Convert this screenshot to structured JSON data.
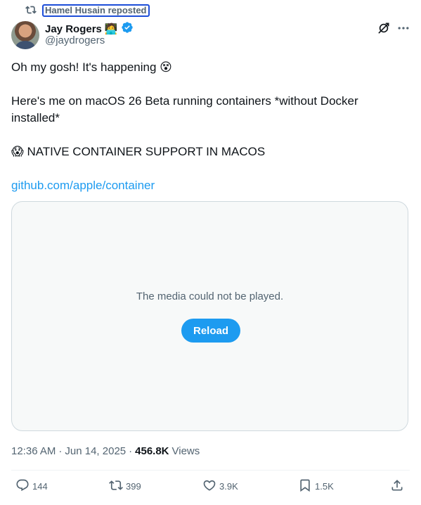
{
  "repost": {
    "label": "Hamel Husain reposted"
  },
  "author": {
    "name": "Jay Rogers",
    "badge_emoji": "🧑‍💻",
    "handle": "@jaydrogers"
  },
  "tweet": {
    "line1": "Oh my gosh! It's happening 😵",
    "line2": "Here's me on macOS 26 Beta running containers *without Docker installed*",
    "line3": "😱 NATIVE CONTAINER SUPPORT IN MACOS",
    "link": "github.com/apple/container"
  },
  "media": {
    "message": "The media could not be played.",
    "reload_label": "Reload"
  },
  "meta": {
    "time": "12:36 AM",
    "sep1": "·",
    "date": "Jun 14, 2025",
    "sep2": "·",
    "views_count": "456.8K",
    "views_label": "Views"
  },
  "actions": {
    "replies": "144",
    "reposts": "399",
    "likes": "3.9K",
    "bookmarks": "1.5K"
  },
  "colors": {
    "accent": "#1d9bf0",
    "text": "#0f1419",
    "muted": "#536471",
    "border": "#cfd9de"
  }
}
